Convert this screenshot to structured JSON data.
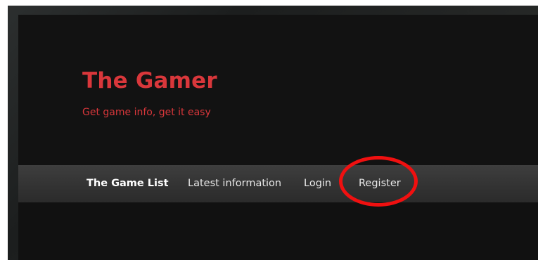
{
  "site": {
    "title": "The Gamer",
    "tagline": "Get game info, get it easy"
  },
  "nav": {
    "items": [
      {
        "label": "The Game List",
        "active": true
      },
      {
        "label": "Latest information",
        "active": false
      },
      {
        "label": "Login",
        "active": false
      },
      {
        "label": "Register",
        "active": false
      }
    ]
  },
  "annotation": {
    "highlighted_item": "Register",
    "color": "#f01010"
  },
  "colors": {
    "brand": "#d9373b",
    "background": "#111111",
    "navbar": "#353535",
    "nav_text": "#e9e9e9"
  }
}
